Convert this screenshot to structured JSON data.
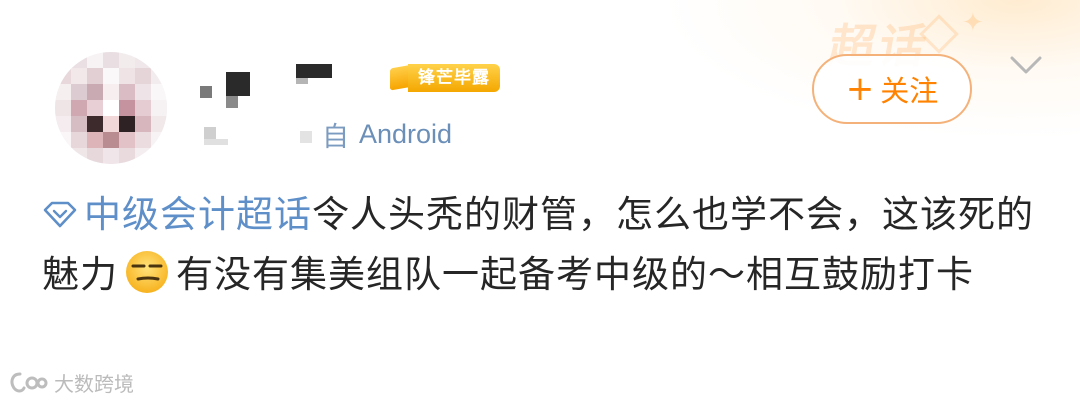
{
  "header": {
    "badge_label": "锋芒毕露",
    "source_text": "Android",
    "source_prefix_partial": "自",
    "follow_plus": "+",
    "follow_label": "关注",
    "background_watermark": "超话"
  },
  "post": {
    "topic": "中级会计超话",
    "text_part1": "令人头秃的财管，怎么也学不会，这该死的魅力",
    "emoji_name": "smirk-emoji",
    "text_part2": "有没有集美组队一起备考中级的～相互鼓励打卡"
  },
  "watermark": {
    "text": "大数跨境"
  },
  "colors": {
    "accent_orange": "#ff8200",
    "topic_blue": "#5f8fc8",
    "badge_gold": "#f4a700",
    "text_dark": "#262626"
  },
  "icons": {
    "topic": "diamond-topic-icon",
    "menu": "chevron-down-icon",
    "watermark_logo": "watermark-logo-icon"
  }
}
